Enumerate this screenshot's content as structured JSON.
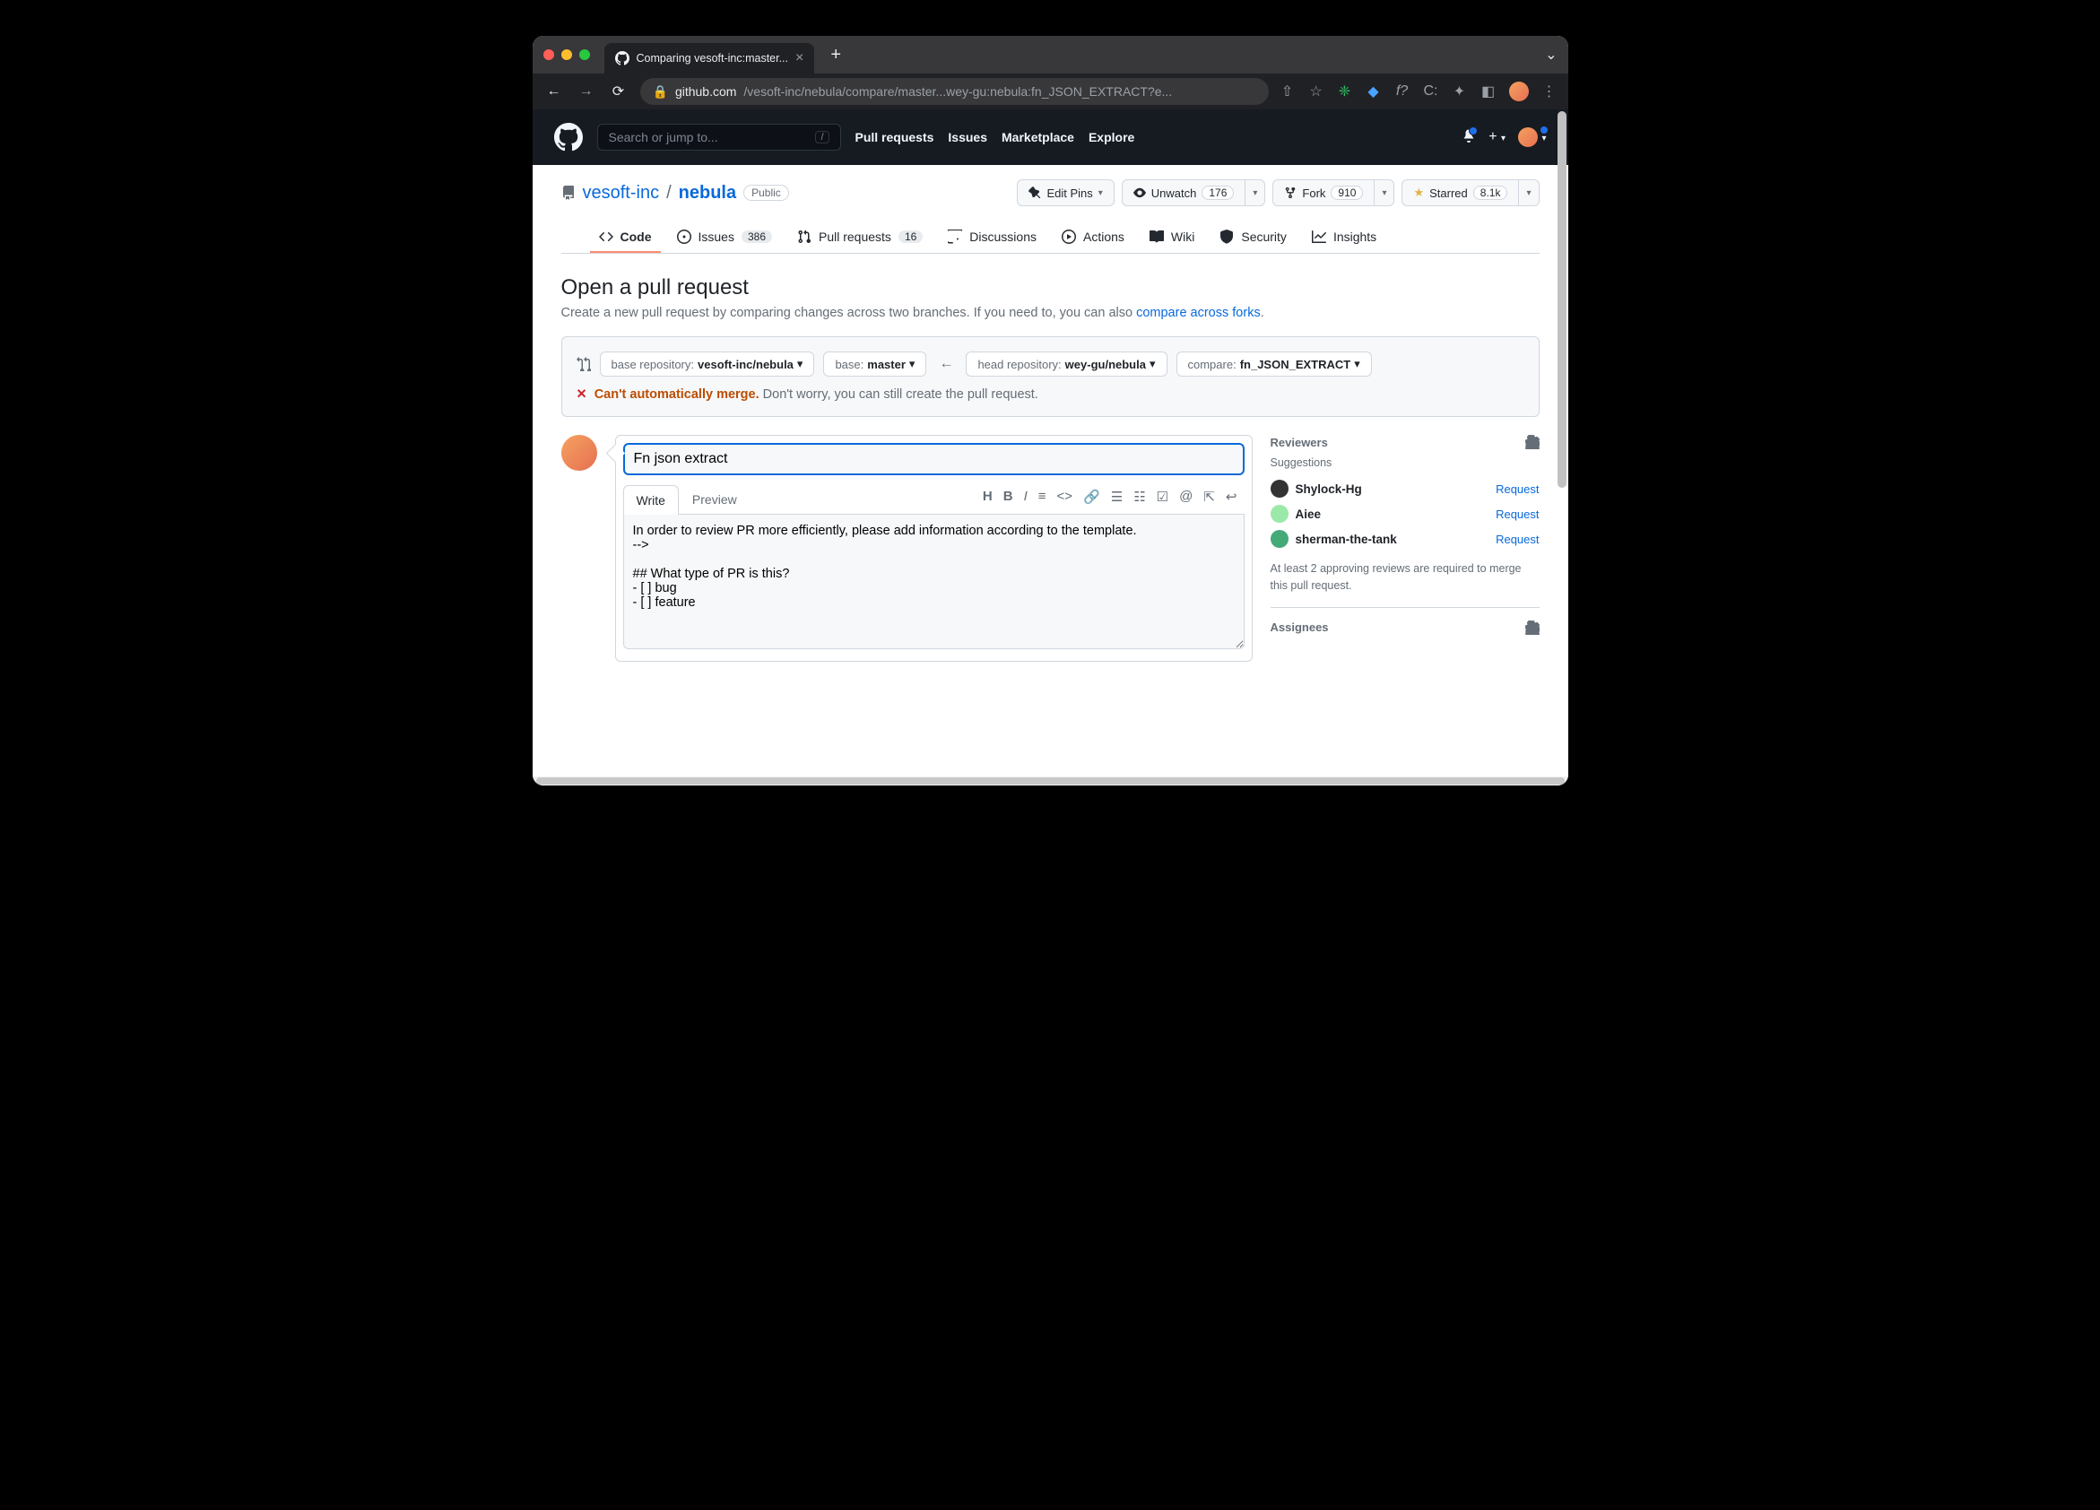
{
  "browser": {
    "tab_title": "Comparing vesoft-inc:master...",
    "url_prefix": "github.com",
    "url_path": "/vesoft-inc/nebula/compare/master...wey-gu:nebula:fn_JSON_EXTRACT?e..."
  },
  "gh_header": {
    "search_placeholder": "Search or jump to...",
    "slash": "/",
    "nav": {
      "pulls": "Pull requests",
      "issues": "Issues",
      "marketplace": "Marketplace",
      "explore": "Explore"
    }
  },
  "repo": {
    "owner": "vesoft-inc",
    "name": "nebula",
    "visibility": "Public",
    "actions": {
      "edit_pins": "Edit Pins",
      "unwatch": "Unwatch",
      "watch_count": "176",
      "fork": "Fork",
      "fork_count": "910",
      "starred": "Starred",
      "star_count": "8.1k"
    },
    "tabs": {
      "code": "Code",
      "issues": "Issues",
      "issues_count": "386",
      "pulls": "Pull requests",
      "pulls_count": "16",
      "discussions": "Discussions",
      "actions": "Actions",
      "wiki": "Wiki",
      "security": "Security",
      "insights": "Insights"
    }
  },
  "page": {
    "title": "Open a pull request",
    "subtitle_a": "Create a new pull request by comparing changes across two branches. If you need to, you can also ",
    "subtitle_link": "compare across forks",
    "subtitle_dot": "."
  },
  "compare": {
    "base_repo_lbl": "base repository: ",
    "base_repo": "vesoft-inc/nebula",
    "base_lbl": "base: ",
    "base": "master",
    "head_repo_lbl": "head repository: ",
    "head_repo": "wey-gu/nebula",
    "compare_lbl": "compare: ",
    "compare": "fn_JSON_EXTRACT",
    "merge_err": "Can't automatically merge.",
    "merge_rest": " Don't worry, you can still create the pull request."
  },
  "form": {
    "title_value": "Fn json extract",
    "tabs": {
      "write": "Write",
      "preview": "Preview"
    },
    "body": "In order to review PR more efficiently, please add information according to the template.\n-->\n\n## What type of PR is this?\n- [ ] bug\n- [ ] feature"
  },
  "sidebar": {
    "reviewers_title": "Reviewers",
    "suggestions": "Suggestions",
    "reviewers": [
      {
        "name": "Shylock-Hg",
        "action": "Request",
        "color": "#333"
      },
      {
        "name": "Aiee",
        "action": "Request",
        "color": "#9be9a8"
      },
      {
        "name": "sherman-the-tank",
        "action": "Request",
        "color": "#4a7"
      }
    ],
    "note": "At least 2 approving reviews are required to merge this pull request.",
    "assignees_title": "Assignees"
  }
}
